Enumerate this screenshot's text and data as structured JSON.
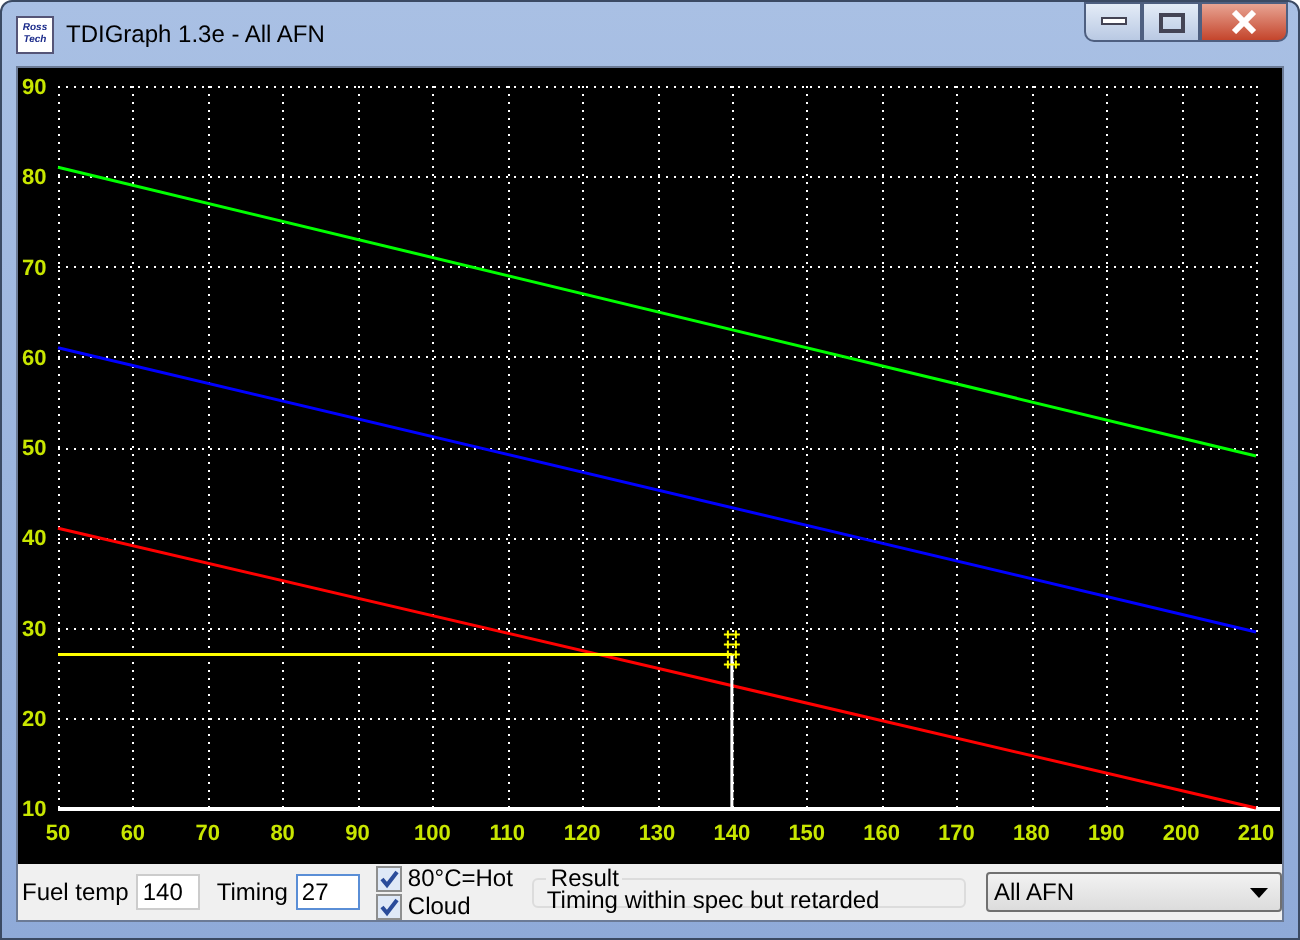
{
  "window": {
    "title": "TDIGraph 1.3e - All AFN",
    "icon_text": "Ross Tech"
  },
  "chart_data": {
    "type": "line",
    "xlim": [
      50,
      210
    ],
    "ylim": [
      10,
      90
    ],
    "xticks": [
      50,
      60,
      70,
      80,
      90,
      100,
      110,
      120,
      130,
      140,
      150,
      160,
      170,
      180,
      190,
      200,
      210
    ],
    "yticks": [
      10,
      20,
      30,
      40,
      50,
      60,
      70,
      80,
      90
    ],
    "x": [
      50,
      210
    ],
    "grid": true,
    "series": [
      {
        "color": "#00ff00",
        "values": [
          81,
          49
        ]
      },
      {
        "color": "#0000ff",
        "values": [
          61,
          29.5
        ]
      },
      {
        "color": "#ff0000",
        "values": [
          41,
          10
        ]
      }
    ],
    "ref_lines": [
      {
        "axis": "y",
        "value": 27,
        "color": "#ffff00"
      },
      {
        "axis": "x",
        "value": 140,
        "color": "#ffffff"
      }
    ]
  },
  "controls": {
    "fuel_temp": {
      "label": "Fuel temp",
      "value": "140"
    },
    "timing": {
      "label": "Timing",
      "value": "27"
    },
    "checkboxes": [
      {
        "label": "80°C=Hot",
        "checked": true
      },
      {
        "label": "Cloud",
        "checked": true
      }
    ],
    "result": {
      "label": "Result",
      "text": "Timing within spec but retarded"
    },
    "dropdown": {
      "value": "All AFN"
    }
  }
}
